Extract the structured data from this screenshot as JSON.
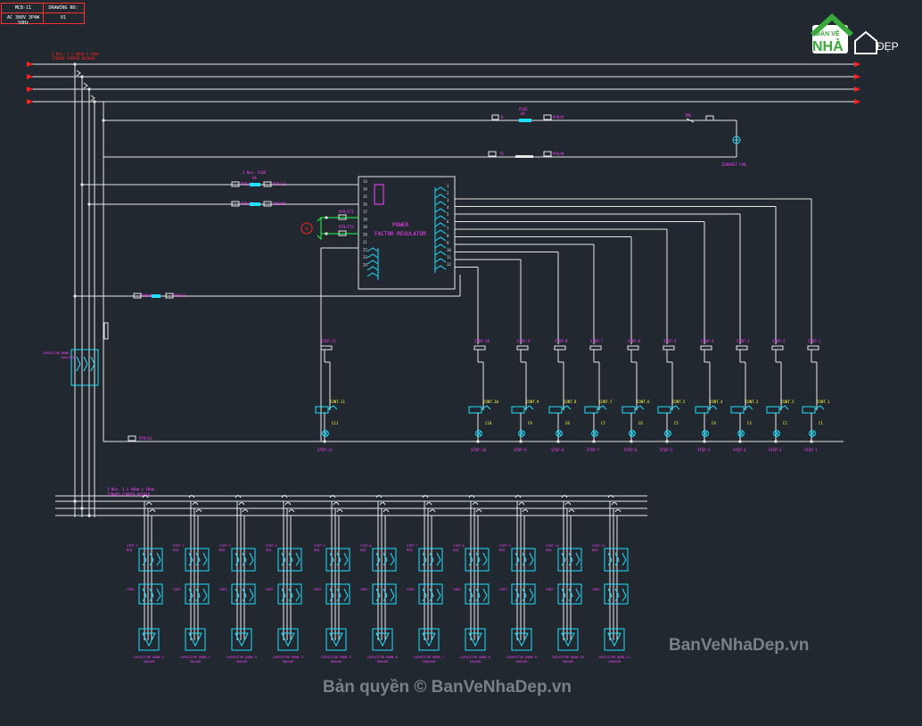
{
  "title_block": {
    "panel": "MCB-11",
    "drawing_no_label": "DRAWING NO:",
    "supply": "AC 380V 3P4W 50Hz",
    "drawing_no": "01"
  },
  "logo": {
    "line1": "BẢN VẼ",
    "line2": "NHÀ",
    "line3": "ĐẸP"
  },
  "labels": {
    "main_busbar": "4 Nos. 3 x 40mm X 10mm",
    "main_busbar2": "TINNED COPPER BUSBAR",
    "fuse_top": "FUSE",
    "fuse_top_rating": "6A",
    "fuse_pair": "2 Nos. FUSE",
    "fuse_pair_rating": "6A",
    "r": "R",
    "n": "N",
    "ts": "TS",
    "exhaust_fan": "EXHAUST FAN",
    "pfr_title1": "POWER",
    "pfr_title2": "FACTOR REGULATOR",
    "ct_mark": "A",
    "sub_busbar": "3 Nos. 3 x 40mm x 10mm",
    "sub_busbar2": "TINNED COPPER BUSBAR",
    "isolator1": "CAPACITOR BANK",
    "isolator2": "ISOLATOR"
  },
  "wire_tags": [
    "PFR/R",
    "PFR/N",
    "PFR/L1",
    "PFR/L2",
    "PFR/L3",
    "PFR/N1",
    "PFR/CT1",
    "PFR/CT2",
    "FAN/N",
    "PFR/A1"
  ],
  "pfr_terminals_left": [
    "13",
    "14",
    "15",
    "16",
    "17",
    "18",
    "19",
    "20",
    "21",
    "22",
    "23",
    "24"
  ],
  "pfr_terminals_right": [
    "1",
    "2",
    "3",
    "4",
    "5",
    "6",
    "7",
    "8",
    "9",
    "10",
    "11",
    "12"
  ],
  "steps": [
    {
      "step": "STEP-11",
      "cont": "CONT.11",
      "cap": "C11"
    },
    {
      "step": "STEP-10",
      "cont": "CONT.10",
      "cap": "C10"
    },
    {
      "step": "STEP-9",
      "cont": "CONT.9",
      "cap": "C9"
    },
    {
      "step": "STEP-8",
      "cont": "CONT.8",
      "cap": "C8"
    },
    {
      "step": "STEP-7",
      "cont": "CONT.7",
      "cap": "C7"
    },
    {
      "step": "STEP-6",
      "cont": "CONT.6",
      "cap": "C6"
    },
    {
      "step": "STEP-5",
      "cont": "CONT.5",
      "cap": "C5"
    },
    {
      "step": "STEP-4",
      "cont": "CONT.4",
      "cap": "C4"
    },
    {
      "step": "STEP-3",
      "cont": "CONT.3",
      "cap": "C3"
    },
    {
      "step": "STEP-2",
      "cont": "CONT.2",
      "cap": "C2"
    },
    {
      "step": "STEP-1",
      "cont": "CONT.1",
      "cap": "C1"
    }
  ],
  "banks": [
    {
      "name": "CAPACITOR BANK-1",
      "kvar": "30kVAR",
      "step": "STEP 1"
    },
    {
      "name": "CAPACITOR BANK-2",
      "kvar": "30kVAR",
      "step": "STEP 2"
    },
    {
      "name": "CAPACITOR BANK-3",
      "kvar": "30kVAR",
      "step": "STEP 3"
    },
    {
      "name": "CAPACITOR BANK-4",
      "kvar": "50kVAR",
      "step": "STEP 4"
    },
    {
      "name": "CAPACITOR BANK-5",
      "kvar": "50kVAR",
      "step": "STEP 5"
    },
    {
      "name": "CAPACITOR BANK-6",
      "kvar": "50kVAR",
      "step": "STEP 6"
    },
    {
      "name": "CAPACITOR BANK-7",
      "kvar": "100kVAR",
      "step": "STEP 7"
    },
    {
      "name": "CAPACITOR BANK-8",
      "kvar": "50kVAR",
      "step": "STEP 8"
    },
    {
      "name": "CAPACITOR BANK-9",
      "kvar": "50kVAR",
      "step": "STEP 9"
    },
    {
      "name": "CAPACITOR BANK-10",
      "kvar": "50kVAR",
      "step": "STEP 10"
    },
    {
      "name": "CAPACITOR BANK-11",
      "kvar": "100kVAR",
      "step": "STEP 11"
    }
  ],
  "bank_mcb_text": "MCB",
  "bank_cont_text": "CONT.",
  "watermark1": "BanVeNhaDep.vn",
  "watermark2": "Bản quyền © BanVeNhaDep.vn",
  "colors": {
    "background": "#212830",
    "wire": "#e8e8e8",
    "phase_arrow": "#ff2020",
    "magenta_text": "#ff40ff",
    "cyan_device": "#20e0ff",
    "yellow_text": "#ffff40",
    "green": "#20ff40"
  }
}
